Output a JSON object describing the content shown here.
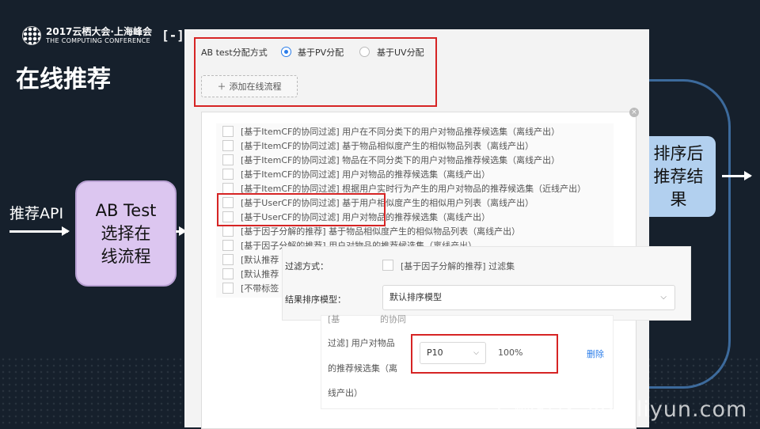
{
  "header": {
    "logo_line1": "2017云栖大会·上海峰会",
    "logo_line2": "THE COMPUTING CONFERENCE",
    "aliyun_logo": "[-]",
    "title": "在线推荐"
  },
  "flow": {
    "api_label": "推荐API",
    "ab_box": "AB Test\n选择在\n线流程",
    "rank_box": "排序后\n推荐结\n果"
  },
  "ab_config": {
    "label": "AB test分配方式",
    "option_pv": "基于PV分配",
    "option_uv": "基于UV分配",
    "selected": "pv",
    "add_flow": "添加在线流程"
  },
  "candidate_list": [
    "[基于ItemCF的协同过滤] 用户在不同分类下的用户对物品推荐候选集（离线产出）",
    "[基于ItemCF的协同过滤] 基于物品相似度产生的相似物品列表（离线产出）",
    "[基于ItemCF的协同过滤] 物品在不同分类下的用户对物品推荐候选集（离线产出）",
    "[基于ItemCF的协同过滤] 用户对物品的推荐候选集（离线产出）",
    "[基于ItemCF的协同过滤] 根据用户实时行为产生的用户对物品的推荐候选集（近线产出）",
    "[基于UserCF的协同过滤] 基于用户相似度产生的相似用户列表（离线产出）",
    "[基于UserCF的协同过滤] 用户对物品的推荐候选集（离线产出）",
    "[基于因子分解的推荐] 基于物品相似度产生的相似物品列表（离线产出）",
    "[基于因子分解的推荐] 用户对物品的推荐候选集（离线产出）",
    "[默认推荐",
    "[默认推荐",
    "[不带标签"
  ],
  "popup": {
    "filter_label": "过滤方式：",
    "filter_option": "[基于因子分解的推荐] 过滤集",
    "model_label": "结果排序模型：",
    "model_value": "默认排序模型"
  },
  "sub_item": {
    "text_top": "[基",
    "text_top2": "的协同",
    "line1": "过滤] 用户对物品",
    "line2": "的推荐候选集（离",
    "line3": "线产出）",
    "select_value": "P10",
    "percent": "100%",
    "delete": "删除"
  },
  "watermark": "云栖社区 yq.aliyun.com",
  "colors": {
    "accent": "#2b7de9",
    "highlight": "#d62424",
    "ab_box": "#dcc6f0",
    "rank_box": "#b2d0ef"
  }
}
